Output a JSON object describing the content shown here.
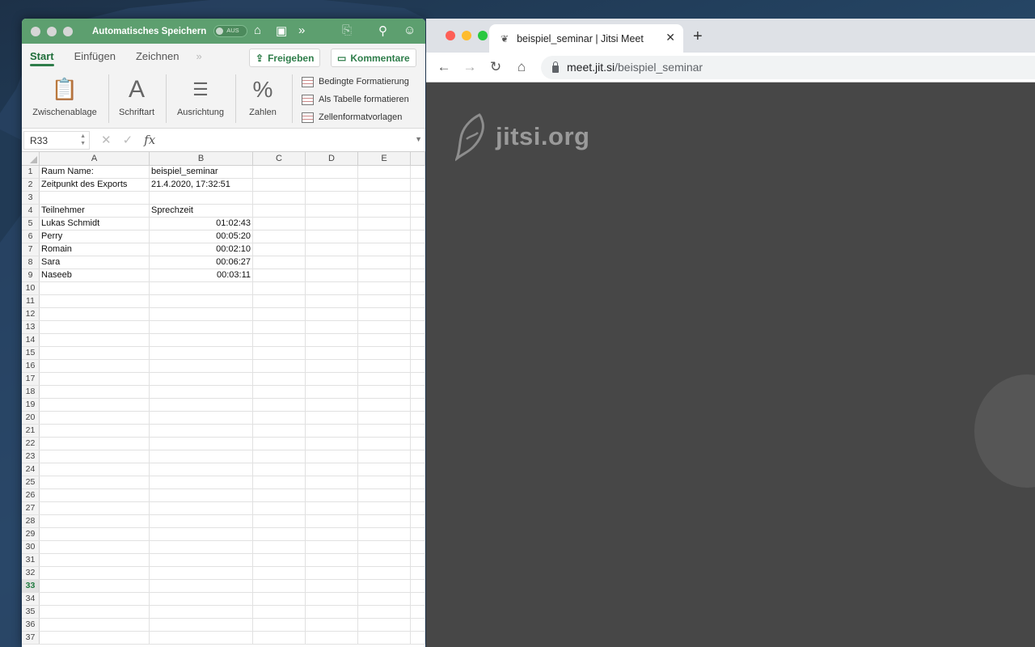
{
  "excel": {
    "autosave_label": "Automatisches Speichern",
    "autosave_state": "AUS",
    "tabs": [
      "Start",
      "Einfügen",
      "Zeichnen"
    ],
    "share_label": "Freigeben",
    "comments_label": "Kommentare",
    "ribbon": {
      "clipboard": "Zwischenablage",
      "font": "Schriftart",
      "alignment": "Ausrichtung",
      "numbers": "Zahlen",
      "conditional": "Bedingte Formatierung",
      "as_table": "Als Tabelle formatieren",
      "cell_styles": "Zellenformatvorlagen"
    },
    "name_box": "R33",
    "fx": "fx",
    "columns": [
      "A",
      "B",
      "C",
      "D",
      "E"
    ],
    "selected_row": 33,
    "cells": [
      {
        "row": 1,
        "a": "Raum Name:",
        "b": "beispiel_seminar"
      },
      {
        "row": 2,
        "a": "Zeitpunkt des Exports",
        "b": "21.4.2020, 17:32:51"
      },
      {
        "row": 4,
        "a": "Teilnehmer",
        "b": "Sprechzeit"
      },
      {
        "row": 5,
        "a": "Lukas Schmidt",
        "b": "01:02:43",
        "num": true
      },
      {
        "row": 6,
        "a": "Perry",
        "b": "00:05:20",
        "num": true
      },
      {
        "row": 7,
        "a": "Romain",
        "b": "00:02:10",
        "num": true
      },
      {
        "row": 8,
        "a": "Sara",
        "b": "00:06:27",
        "num": true
      },
      {
        "row": 9,
        "a": "Naseeb",
        "b": "00:03:11",
        "num": true
      }
    ],
    "row_count": 37,
    "accent": "#5d9f6f"
  },
  "browser": {
    "tab_title": "beispiel_seminar | Jitsi Meet",
    "url_host": "meet.jit.si",
    "url_path": "/beispiel_seminar",
    "logo_text": "jitsi.org",
    "bg_color": "#474747"
  }
}
